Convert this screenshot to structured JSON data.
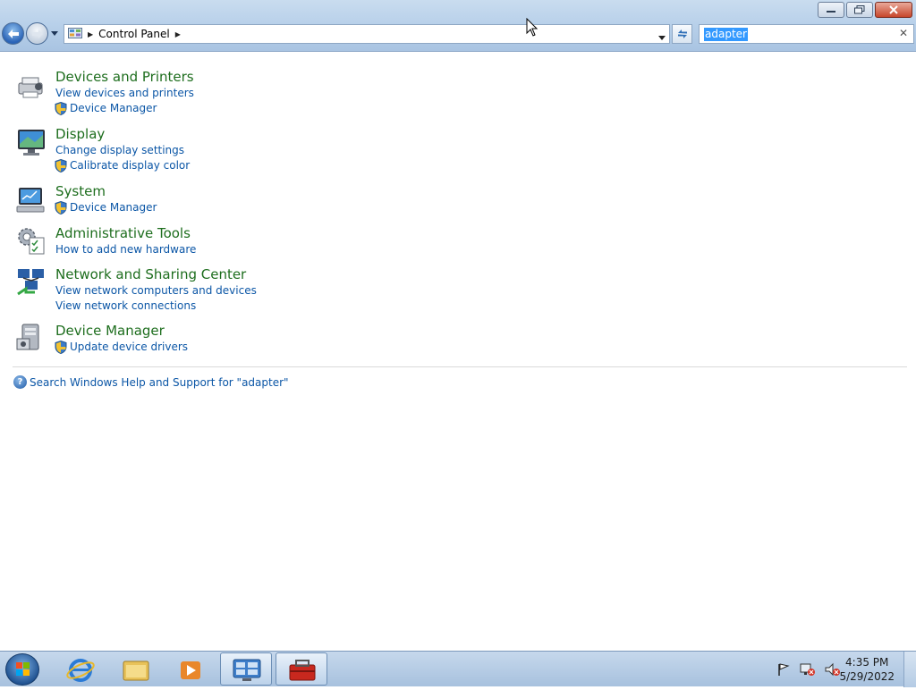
{
  "address": {
    "breadcrumb": "Control Panel",
    "search_value": "adapter"
  },
  "results": [
    {
      "title": "Devices and Printers",
      "icon": "devices-printers-icon",
      "links": [
        {
          "label": "View devices and printers",
          "shield": false
        },
        {
          "label": "Device Manager",
          "shield": true
        }
      ]
    },
    {
      "title": "Display",
      "icon": "display-icon",
      "links": [
        {
          "label": "Change display settings",
          "shield": false
        },
        {
          "label": "Calibrate display color",
          "shield": true
        }
      ]
    },
    {
      "title": "System",
      "icon": "system-icon",
      "links": [
        {
          "label": "Device Manager",
          "shield": true
        }
      ]
    },
    {
      "title": "Administrative Tools",
      "icon": "administrative-tools-icon",
      "links": [
        {
          "label": "How to add new hardware",
          "shield": false
        }
      ]
    },
    {
      "title": "Network and Sharing Center",
      "icon": "network-sharing-icon",
      "links": [
        {
          "label": "View network computers and devices",
          "shield": false
        },
        {
          "label": "View network connections",
          "shield": false
        }
      ]
    },
    {
      "title": "Device Manager",
      "icon": "device-manager-icon",
      "links": [
        {
          "label": "Update device drivers",
          "shield": true
        }
      ]
    }
  ],
  "help_link": "Search Windows Help and Support for \"adapter\"",
  "taskbar": {
    "items": [
      "start-orb",
      "internet-explorer-icon",
      "windows-explorer-icon",
      "media-player-icon",
      "control-panel-icon",
      "toolbox-icon"
    ],
    "time": "4:35 PM",
    "date": "5/29/2022"
  },
  "colors": {
    "title_green": "#1e6e1e",
    "link_blue": "#0b56a6",
    "selection": "#3399ff"
  }
}
